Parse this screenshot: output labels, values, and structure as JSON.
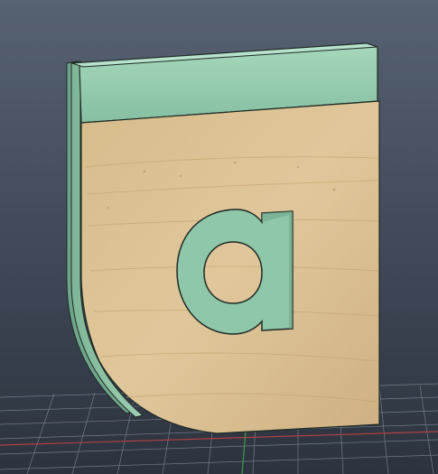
{
  "viewport": {
    "background_top": "#4f5a6b",
    "background_bottom": "#2e3541",
    "grid_color": "#8a929c",
    "x_axis_color": "#b04040",
    "y_axis_color": "#3f9a4a"
  },
  "model": {
    "engraved_letter": "a",
    "face_material": "wood",
    "wood_base": "#d8bd8f",
    "wood_grain": "#c5a673",
    "green_layer": "#8fc7ab",
    "green_layer_dark": "#6fa58b",
    "edge_color": "#1f2a24"
  },
  "icons": {
    "part_body": "3d-part-icon",
    "letter_cutout": "letter-a-cutout-icon"
  }
}
